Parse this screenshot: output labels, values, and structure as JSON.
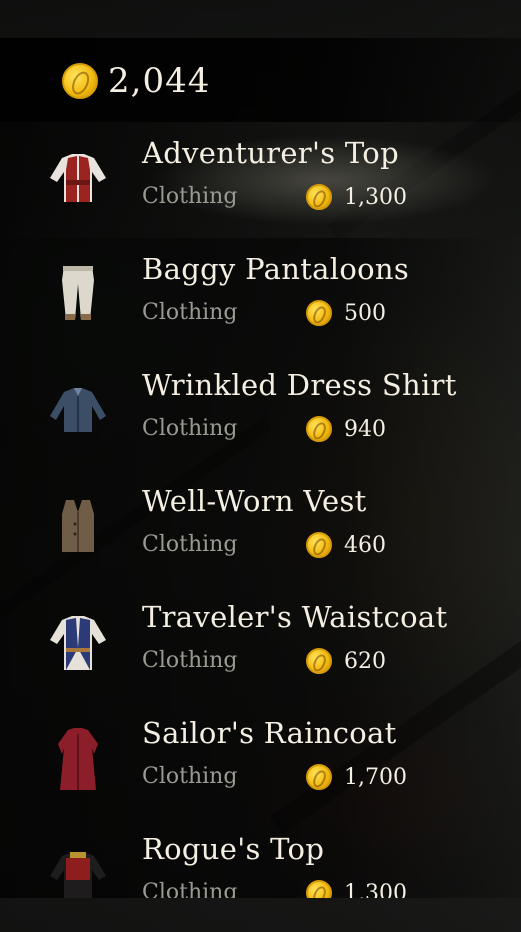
{
  "wallet": {
    "balance": "2,044"
  },
  "items": [
    {
      "name": "Adventurer's Top",
      "category": "Clothing",
      "price": "1,300",
      "icon": "red-vest-shirt-icon",
      "selected": true
    },
    {
      "name": "Baggy Pantaloons",
      "category": "Clothing",
      "price": "500",
      "icon": "white-pants-icon"
    },
    {
      "name": "Wrinkled Dress Shirt",
      "category": "Clothing",
      "price": "940",
      "icon": "blue-dress-shirt-icon"
    },
    {
      "name": "Well-Worn Vest",
      "category": "Clothing",
      "price": "460",
      "icon": "brown-vest-icon"
    },
    {
      "name": "Traveler's Waistcoat",
      "category": "Clothing",
      "price": "620",
      "icon": "blue-waistcoat-icon"
    },
    {
      "name": "Sailor's Raincoat",
      "category": "Clothing",
      "price": "1,700",
      "icon": "red-raincoat-icon"
    },
    {
      "name": "Rogue's Top",
      "category": "Clothing",
      "price": "1,300",
      "icon": "black-red-top-icon"
    }
  ],
  "colors": {
    "coin": "#f2b90f",
    "text": "#f4efe2",
    "muted": "#9a9a92"
  }
}
